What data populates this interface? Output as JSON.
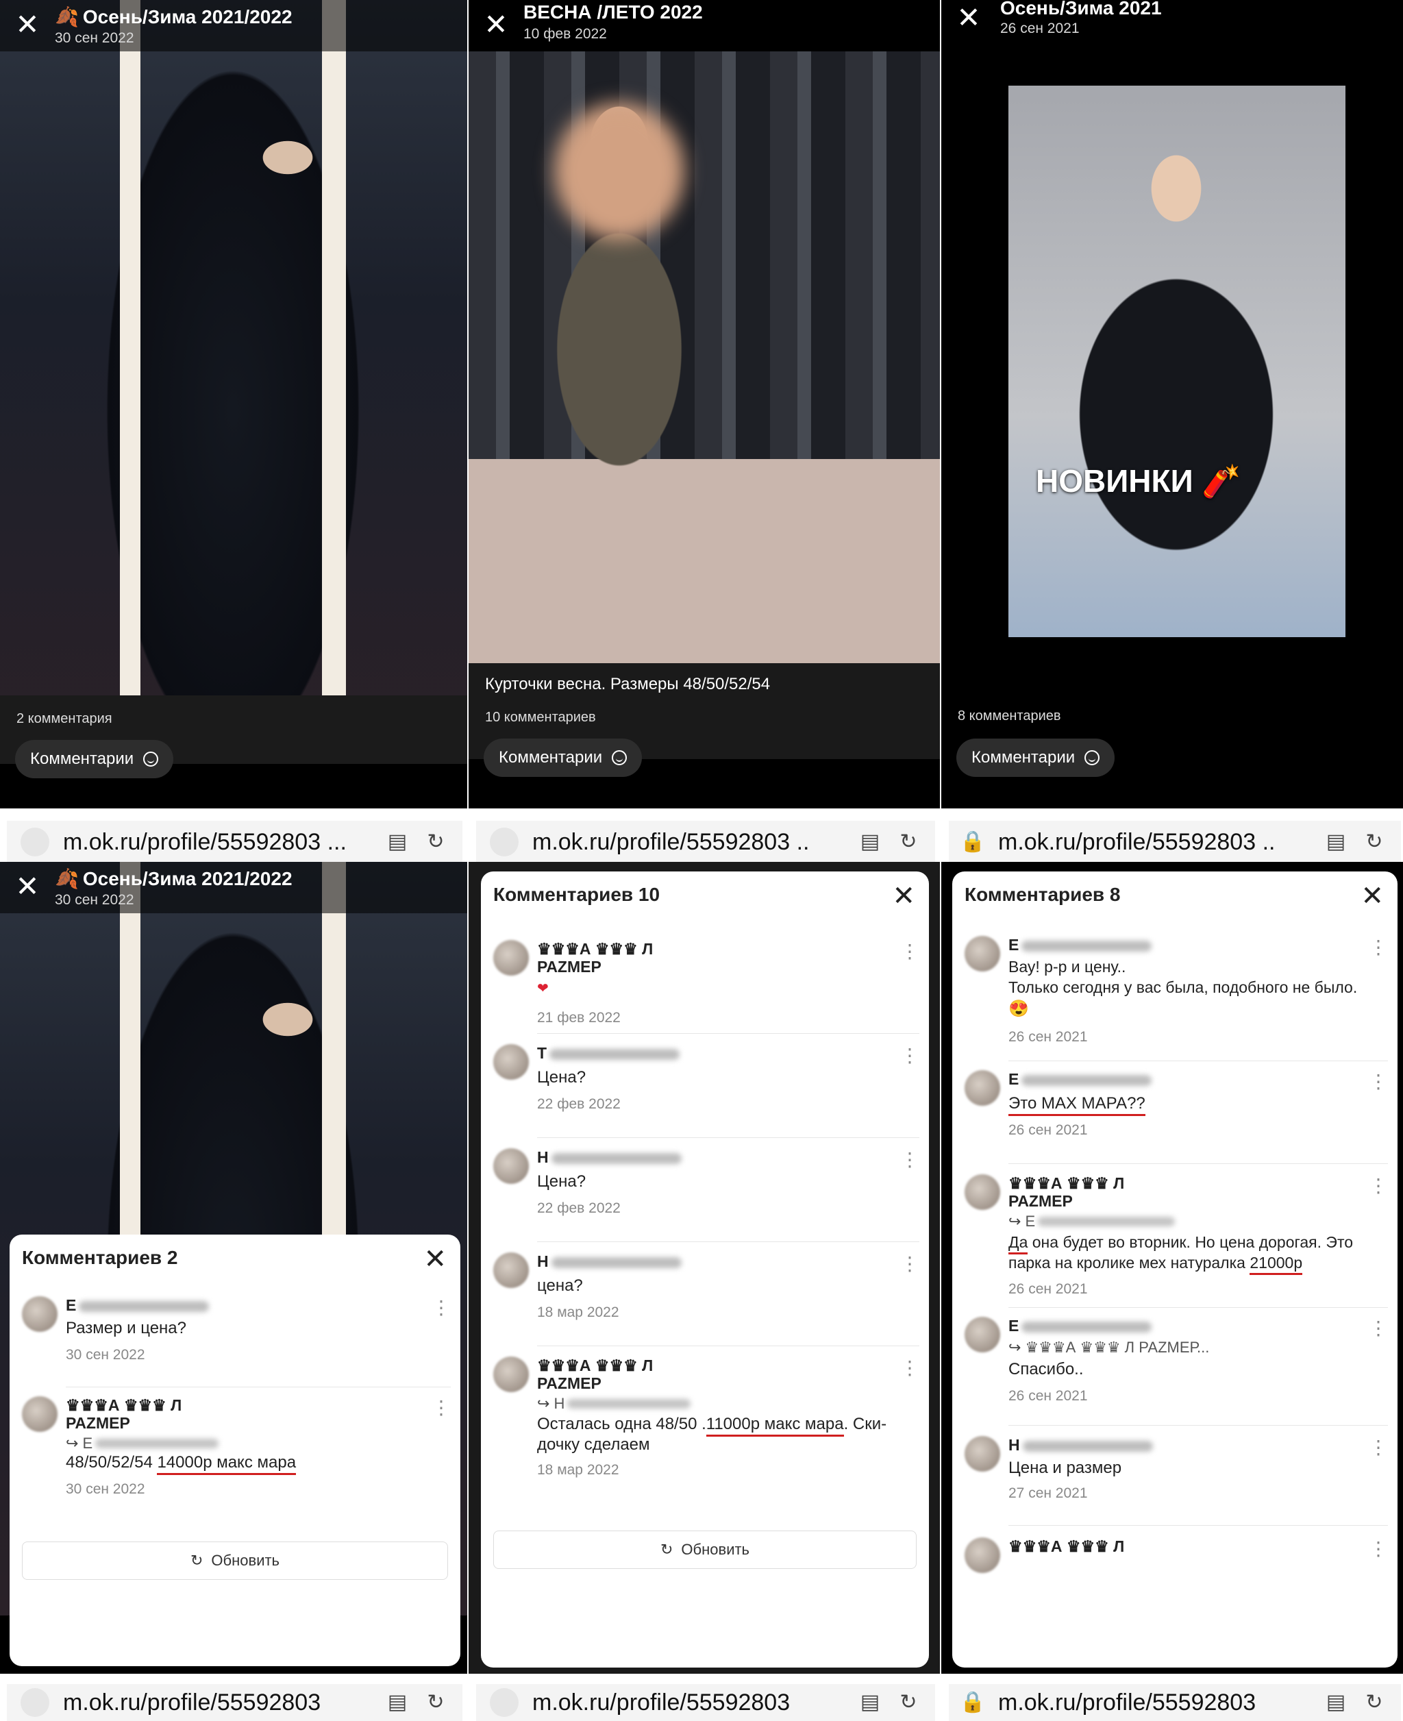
{
  "panels": [
    {
      "title": "Осень/Зима 2021/2022",
      "date": "30 сен 2022",
      "caption": "",
      "comment_count": "2 комментария",
      "comments_button": "Комментарии",
      "url": "m.ok.ru/profile/55592803",
      "url_suffix": "..."
    },
    {
      "title": "ВЕСНА /ЛЕТО 2022",
      "date": "10 фев 2022",
      "caption": "Курточки весна. Размеры 48/50/52/54",
      "comment_count": "10 комментариев",
      "comments_button": "Комментарии",
      "url": "m.ok.ru/profile/55592803",
      "url_suffix": ".."
    },
    {
      "title": "Осень/Зима 2021",
      "date": "26 сен 2021",
      "photo_text": "НОВИНКИ",
      "comment_count": "8 комментариев",
      "comments_button": "Комментарии",
      "url": "m.ok.ru/profile/55592803",
      "url_suffix": ".."
    }
  ],
  "sheets": [
    {
      "panel_title": "Осень/Зима 2021/2022",
      "panel_date": "30 сен 2022",
      "title": "Комментариев 2",
      "refresh": "Обновить",
      "url": "m.ok.ru/profile/55592803",
      "comments": [
        {
          "name": "Е",
          "text": "Размер и цена?",
          "date": "30 сен 2022"
        },
        {
          "name": "♛♛♛А ♛♛♛ Л",
          "name2": "РАZМЕР",
          "reply_to": "Е",
          "text_a": "48/50/52/54 ",
          "text_b": "14000р макс мара",
          "date": "30 сен 2022"
        }
      ]
    },
    {
      "title": "Комментариев 10",
      "refresh": "Обновить",
      "url": "m.ok.ru/profile/55592803",
      "comments": [
        {
          "name": "♛♛♛А ♛♛♛ Л",
          "name2": "РАZМЕР",
          "text": "❤",
          "date": "21 фев 2022"
        },
        {
          "name": "Т",
          "text": "Цена?",
          "date": "22 фев 2022"
        },
        {
          "name": "Н",
          "text": "Цена?",
          "date": "22 фев 2022"
        },
        {
          "name": "Н",
          "text": "цена?",
          "date": "18 мар 2022"
        },
        {
          "name": "♛♛♛А ♛♛♛ Л",
          "name2": "РАZМЕР",
          "reply_to": "Н",
          "text_a": "Осталась одна 48/50 .",
          "text_b": "11000р макс мара",
          "text_c": ". Ски-\nдочку сделаем",
          "date": "18 мар 2022"
        }
      ]
    },
    {
      "title": "Комментариев 8",
      "url": "m.ok.ru/profile/55592803",
      "comments": [
        {
          "name": "Е",
          "text": "Вау! р-р и цену..\nТолько сегодня у вас была, подобного не было.",
          "emoji": "😍",
          "date": "26 сен 2021"
        },
        {
          "name": "Е",
          "text": "Это МАХ МАРА??",
          "date": "26 сен 2021"
        },
        {
          "name": "♛♛♛А ♛♛♛ Л",
          "name2": "РАZМЕР",
          "reply_to": "Е",
          "text_a": "Да",
          "text_b": " она будет во вторник. Но цена дорогая. Это\nпарка на кролике мех натуралка ",
          "text_c": "21000р",
          "date": "26 сен 2021"
        },
        {
          "name": "Е",
          "reply_to": "♛♛♛А ♛♛♛ Л РАZМЕР...",
          "text": "Спасибо..",
          "date": "26 сен 2021"
        },
        {
          "name": "Н",
          "text": "Цена и размер",
          "date": "27 сен 2021"
        },
        {
          "name": "♛♛♛А ♛♛♛ Л"
        }
      ]
    }
  ],
  "colors": {
    "underline": "#d01f1f",
    "dark": "#000000"
  }
}
